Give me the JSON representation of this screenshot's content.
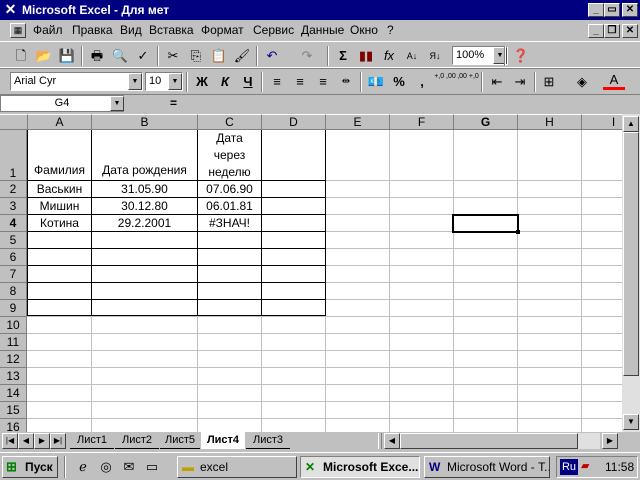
{
  "titlebar": {
    "title": "Microsoft Excel - Для мет"
  },
  "menubar": {
    "items": [
      "Файл",
      "Правка",
      "Вид",
      "Вставка",
      "Формат",
      "Сервис",
      "Данные",
      "Окно",
      "?"
    ]
  },
  "toolbar": {
    "zoom": "100%"
  },
  "format_toolbar": {
    "font_name": "Arial Cyr",
    "font_size": "10",
    "bold": "Ж",
    "italic": "К",
    "underline": "Ч",
    "percent": "%",
    "comma": ",",
    "inc_decimal": "+,0 ,00",
    "dec_decimal": ",00 +,0"
  },
  "formula_bar": {
    "name_box": "G4",
    "equals": "="
  },
  "columns": [
    "A",
    "B",
    "C",
    "D",
    "E",
    "F",
    "G",
    "H",
    "I"
  ],
  "rows": [
    "1",
    "2",
    "3",
    "4",
    "5",
    "6",
    "7",
    "8",
    "9",
    "10",
    "11",
    "12",
    "13",
    "14",
    "15",
    "16"
  ],
  "cells": {
    "A1": "Фамилия",
    "B1": "Дата рождения",
    "C1_line1": "Дата",
    "C1_line2": "через",
    "C1_line3": "неделю",
    "A2": "Васькин",
    "B2": "31.05.90",
    "C2": "07.06.90",
    "A3": "Мишин",
    "B3": "30.12.80",
    "C3": "06.01.81",
    "A4": "Котина",
    "B4": "29.2.2001",
    "C4": "#ЗНАЧ!"
  },
  "sheet_tabs": [
    "Лист1",
    "Лист2",
    "Лист5",
    "Лист4",
    "Лист3"
  ],
  "active_sheet": "Лист4",
  "taskbar": {
    "start": "Пуск",
    "tasks": [
      "excel",
      "Microsoft Exce...",
      "Microsoft Word - Т..."
    ],
    "lang": "Ru",
    "clock": "11:58"
  },
  "colors": {
    "title_bg": "#000080",
    "face": "#c0c0c0",
    "grid": "#c0c0c0"
  }
}
